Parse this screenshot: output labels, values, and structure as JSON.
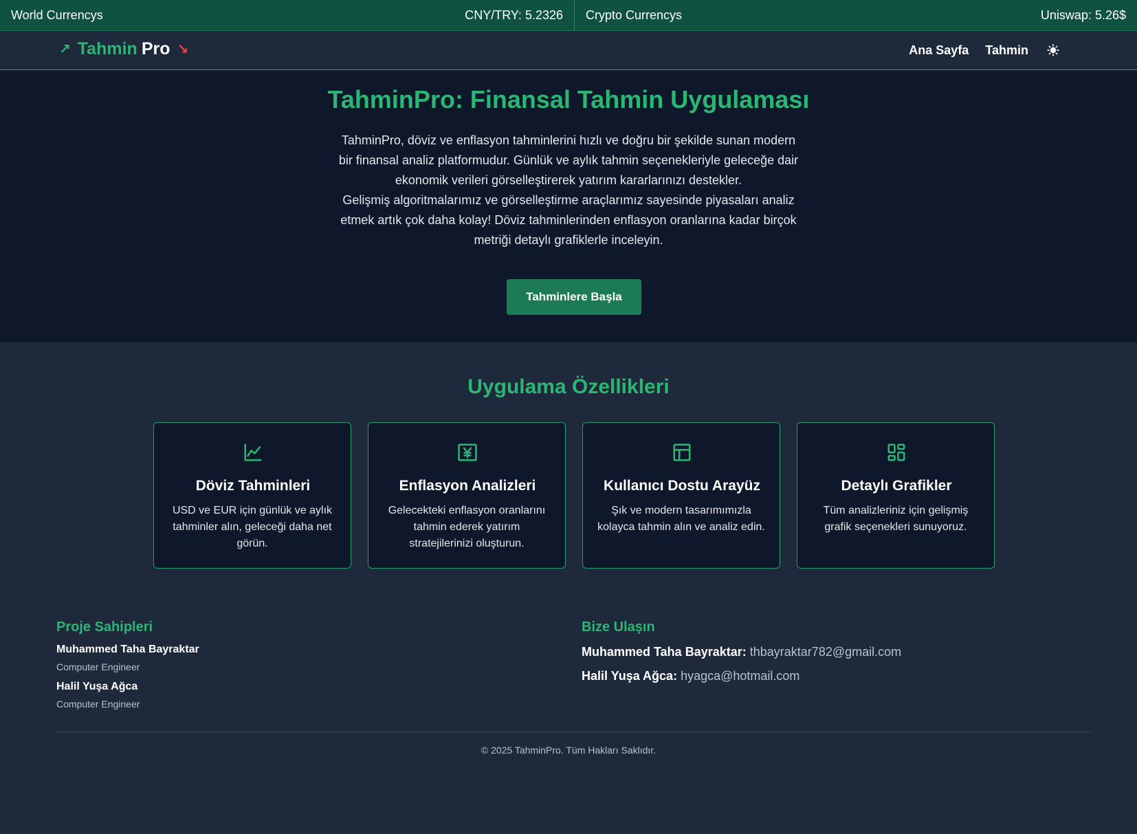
{
  "ticker": {
    "world_label": "World Currencys",
    "world_rate": "CNY/TRY: 5.2326",
    "crypto_label": "Crypto Currencys",
    "crypto_rate": "Uniswap: 5.26$"
  },
  "navbar": {
    "brand_first": "Tahmin",
    "brand_second": "Pro",
    "links": [
      "Ana Sayfa",
      "Tahmin"
    ],
    "theme_icon": "sun-icon"
  },
  "hero": {
    "title": "TahminPro: Finansal Tahmin Uygulaması",
    "paragraph1": "TahminPro, döviz ve enflasyon tahminlerini hızlı ve doğru bir şekilde sunan modern bir finansal analiz platformudur. Günlük ve aylık tahmin seçenekleriyle geleceğe dair ekonomik verileri görselleştirerek yatırım kararlarınızı destekler.",
    "paragraph2": "Gelişmiş algoritmalarımız ve görselleştirme araçlarımız sayesinde piyasaları analiz etmek artık çok daha kolay! Döviz tahminlerinden enflasyon oranlarına kadar birçok metriği detaylı grafiklerle inceleyin.",
    "cta": "Tahminlere Başla"
  },
  "features": {
    "title": "Uygulama Özellikleri",
    "cards": [
      {
        "icon": "line-chart-icon",
        "title": "Döviz Tahminleri",
        "text": "USD ve EUR için günlük ve aylık tahminler alın, geleceği daha net görün."
      },
      {
        "icon": "yen-currency-icon",
        "title": "Enflasyon Analizleri",
        "text": "Gelecekteki enflasyon oranlarını tahmin ederek yatırım stratejilerinizi oluşturun."
      },
      {
        "icon": "layout-icon",
        "title": "Kullanıcı Dostu Arayüz",
        "text": "Şık ve modern tasarımımızla kolayca tahmin alın ve analiz edin."
      },
      {
        "icon": "dashboard-icon",
        "title": "Detaylı Grafikler",
        "text": "Tüm analizleriniz için gelişmiş grafik seçenekleri sunuyoruz."
      }
    ]
  },
  "footer": {
    "owners_title": "Proje Sahipleri",
    "owners": [
      {
        "name": "Muhammed Taha Bayraktar",
        "role": "Computer Engineer"
      },
      {
        "name": "Halil Yuşa Ağca",
        "role": "Computer Engineer"
      }
    ],
    "contact_title": "Bize Ulaşın",
    "contacts": [
      {
        "name": "Muhammed Taha Bayraktar:",
        "email": "thbayraktar782@gmail.com"
      },
      {
        "name": "Halil Yuşa Ağca:",
        "email": "hyagca@hotmail.com"
      }
    ],
    "copyright": "© 2025 TahminPro. Tüm Hakları Saklıdır."
  },
  "colors": {
    "accent": "#2bb673",
    "ticker_bg": "#0f5240",
    "hero_bg": "#0f172a",
    "page_bg": "#1e293b",
    "cta_bg": "#1d7a57",
    "down_arrow": "#ef4444"
  }
}
